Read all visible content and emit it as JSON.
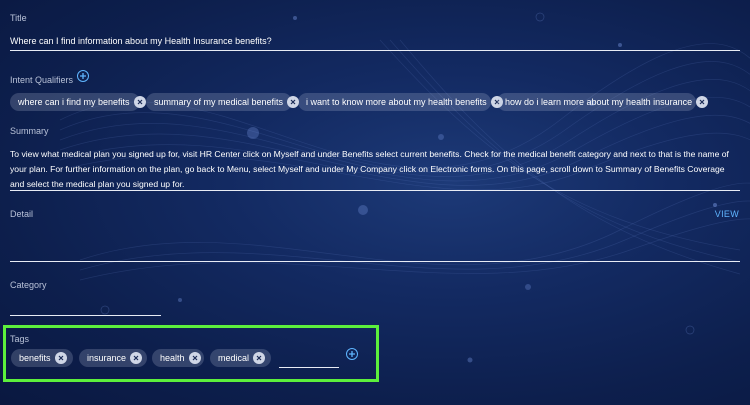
{
  "title": {
    "label": "Title",
    "value": "Where can I find information about my Health Insurance benefits?"
  },
  "intent_qualifiers": {
    "label": "Intent Qualifiers",
    "add_icon": "plus-circle-icon",
    "items": [
      {
        "label": "where can i find my benefits"
      },
      {
        "label": "summary of my medical benefits"
      },
      {
        "label": "i want to know more about my health benefits"
      },
      {
        "label": "how do i learn more about my health insurance"
      }
    ]
  },
  "summary": {
    "label": "Summary",
    "value": "To view what medical plan you signed up for, visit HR Center click on Myself and under Benefits select current benefits. Check for the medical benefit category and next to that is the name of your plan. For further information on the plan, go back to Menu, select Myself and under My Company click on Electronic forms. On this page, scroll down to Summary of Benefits Coverage and select the medical plan you signed up for."
  },
  "detail": {
    "label": "Detail",
    "view_label": "VIEW",
    "value": ""
  },
  "category": {
    "label": "Category",
    "value": ""
  },
  "tags": {
    "label": "Tags",
    "input_value": "",
    "add_icon": "plus-circle-icon",
    "items": [
      {
        "label": "benefits"
      },
      {
        "label": "insurance"
      },
      {
        "label": "health"
      },
      {
        "label": "medical"
      }
    ]
  },
  "colors": {
    "accent": "#5fb5ff",
    "highlight_border": "#5cf03c",
    "chip_bg": "#3b4a73",
    "background": "#132a62"
  }
}
